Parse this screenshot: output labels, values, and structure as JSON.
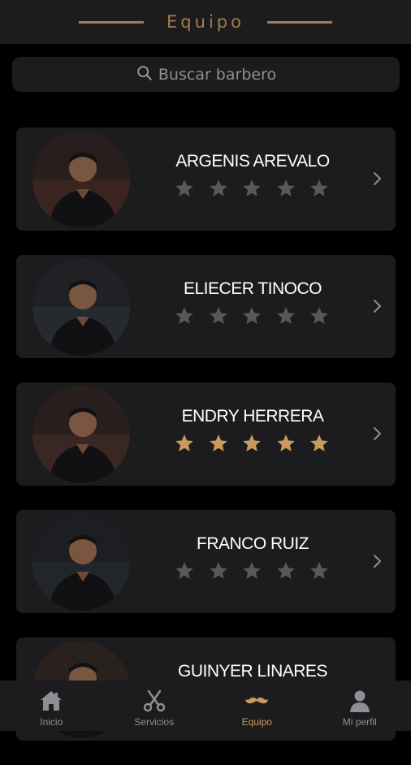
{
  "header": {
    "title": "Equipo"
  },
  "search": {
    "placeholder": "Buscar barbero",
    "icon": "search-icon"
  },
  "colors": {
    "accent": "#a27d4d",
    "star_active": "#c99a5c",
    "star_inactive": "#58585a",
    "card_bg": "#1c1c1e"
  },
  "barbers": [
    {
      "name": "ARGENIS AREVALO",
      "rating": 0
    },
    {
      "name": "ELIECER TINOCO",
      "rating": 0
    },
    {
      "name": "ENDRY HERRERA",
      "rating": 5
    },
    {
      "name": "FRANCO RUIZ",
      "rating": 0
    },
    {
      "name": "GUINYER LINARES",
      "rating": 0
    }
  ],
  "tabs": [
    {
      "label": "Inicio",
      "icon": "home-icon",
      "active": false
    },
    {
      "label": "Servicios",
      "icon": "scissors-icon",
      "active": false
    },
    {
      "label": "Equipo",
      "icon": "mustache-icon",
      "active": true
    },
    {
      "label": "Mi perfil",
      "icon": "user-icon",
      "active": false
    }
  ]
}
